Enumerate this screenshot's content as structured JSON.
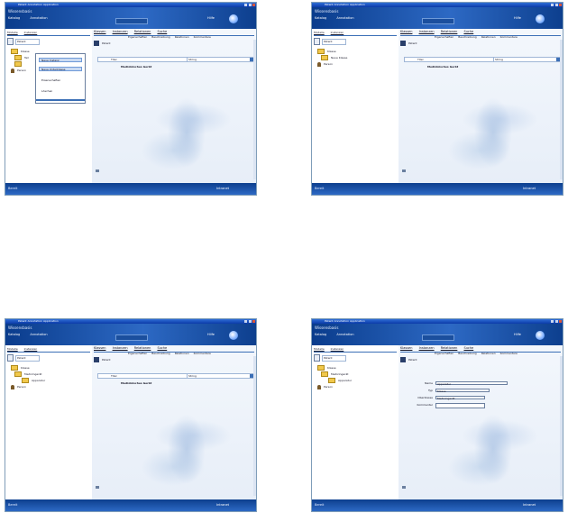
{
  "screens": [
    {
      "title": "Patent Annotation Application",
      "brand": "Wissensbasis",
      "nav": [
        "Katalog",
        "Annotation"
      ],
      "help": "Hilfe",
      "left_tabs": [
        "Modelle",
        "Instanzen"
      ],
      "left_title": "Patent",
      "tree": [
        {
          "label": "Klasse",
          "icon": "folder-icon"
        },
        {
          "label": "Teil",
          "icon": "folder-icon"
        },
        {
          "label": "",
          "icon": "folder-icon"
        },
        {
          "label": "Person",
          "icon": "person-icon"
        }
      ],
      "context_menu": [
        "Neue Instanz",
        "Neue Unterklasse",
        "Eigenschaften",
        "Löschen"
      ],
      "right_tabs": [
        "Klassen",
        "Instanzen",
        "Relationen",
        "Suche"
      ],
      "right_subtabs": [
        "Eigenschaften",
        "Beschreibung",
        "Relationen",
        "Kommentare"
      ],
      "header_label": "Patent",
      "bar_value": "Titel",
      "bar_select": "String",
      "item": "Medizinisches Gerät",
      "status_left": "Bereit",
      "status_right": "Intranet"
    },
    {
      "title": "Patent Annotation Application",
      "brand": "Wissensbasis",
      "nav": [
        "Katalog",
        "Annotation"
      ],
      "help": "Hilfe",
      "left_tabs": [
        "Modelle",
        "Instanzen"
      ],
      "left_title": "Patent",
      "tree": [
        {
          "label": "Klasse",
          "icon": "folder-icon"
        },
        {
          "label": "Neue Klasse",
          "icon": "folder-icon"
        },
        {
          "label": "Person",
          "icon": "person-icon"
        }
      ],
      "right_tabs": [
        "Klassen",
        "Instanzen",
        "Relationen",
        "Suche"
      ],
      "right_subtabs": [
        "Eigenschaften",
        "Beschreibung",
        "Relationen",
        "Kommentare"
      ],
      "header_label": "Patent",
      "bar_value": "Titel",
      "bar_select": "String",
      "item": "Medizinisches Gerät",
      "status_left": "Bereit",
      "status_right": "Intranet"
    },
    {
      "title": "Patent Annotation Application",
      "brand": "Wissensbasis",
      "nav": [
        "Katalog",
        "Annotation"
      ],
      "help": "Hilfe",
      "left_tabs": [
        "Modelle",
        "Instanzen"
      ],
      "left_title": "Patent",
      "tree": [
        {
          "label": "Klasse",
          "icon": "folder-icon"
        },
        {
          "label": "Medizingerät",
          "icon": "folder-icon"
        },
        {
          "label": "Apparatur",
          "icon": "folder-icon"
        },
        {
          "label": "Person",
          "icon": "person-icon"
        }
      ],
      "right_tabs": [
        "Klassen",
        "Instanzen",
        "Relationen",
        "Suche"
      ],
      "right_subtabs": [
        "Eigenschaften",
        "Beschreibung",
        "Relationen",
        "Kommentare"
      ],
      "header_label": "Patent",
      "bar_value": "Titel",
      "bar_select": "String",
      "item": "Medizinisches Gerät",
      "status_left": "Bereit",
      "status_right": "Intranet"
    },
    {
      "title": "Patent Annotation Application",
      "brand": "Wissensbasis",
      "nav": [
        "Katalog",
        "Annotation"
      ],
      "help": "Hilfe",
      "left_tabs": [
        "Modelle",
        "Instanzen"
      ],
      "left_title": "Patent",
      "tree": [
        {
          "label": "Klasse",
          "icon": "folder-icon"
        },
        {
          "label": "Medizingerät",
          "icon": "folder-icon"
        },
        {
          "label": "Apparatur",
          "icon": "folder-icon"
        },
        {
          "label": "Person",
          "icon": "person-icon"
        }
      ],
      "right_tabs": [
        "Klassen",
        "Instanzen",
        "Relationen",
        "Suche"
      ],
      "right_subtabs": [
        "Eigenschaften",
        "Beschreibung",
        "Relationen",
        "Kommentare"
      ],
      "header_label": "Patent",
      "properties": [
        {
          "label": "Name",
          "value": "Apparatur"
        },
        {
          "label": "Typ",
          "value": "Klasse"
        },
        {
          "label": "Oberklasse",
          "value": "Medizingerät"
        },
        {
          "label": "Kommentar",
          "value": ""
        }
      ],
      "status_left": "Bereit",
      "status_right": "Intranet"
    }
  ]
}
